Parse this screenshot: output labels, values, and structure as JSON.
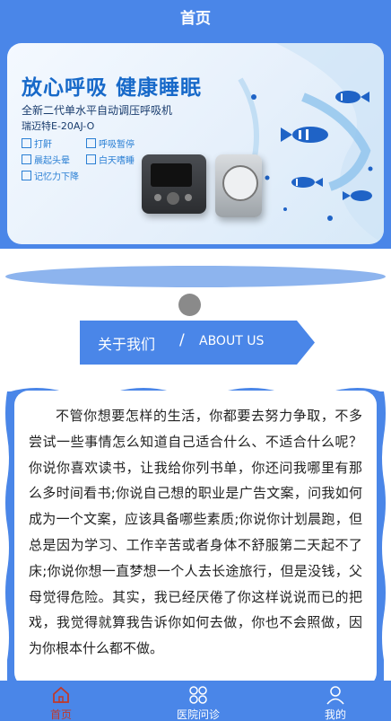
{
  "header": {
    "title": "首页"
  },
  "banner": {
    "headline": "放心呼吸  健康睡眠",
    "subtitle1": "全新二代单水平自动调压呼吸机",
    "subtitle2": "瑞迈特E-20AJ-O",
    "features": [
      "打鼾",
      "呼吸暂停",
      "晨起头晕",
      "白天嗜睡",
      "记忆力下降"
    ]
  },
  "about": {
    "title_cn": "关于我们",
    "separator": "/",
    "title_en": "ABOUT US"
  },
  "content": {
    "paragraph": "不管你想要怎样的生活，你都要去努力争取，不多尝试一些事情怎么知道自己适合什么、不适合什么呢？你说你喜欢读书，让我给你列书单，你还问我哪里有那么多时间看书;你说自己想的职业是广告文案，问我如何成为一个文案，应该具备哪些素质;你说你计划晨跑，但总是因为学习、工作辛苦或者身体不舒服第二天起不了床;你说你想一直梦想一个人去长途旅行，但是没钱，父母觉得危险。其实，我已经厌倦了你这样说说而已的把戏，我觉得就算我告诉你如何去做，你也不会照做，因为你根本什么都不做。"
  },
  "bottom_nav": [
    {
      "label": "首页",
      "icon": "home-icon",
      "active": true
    },
    {
      "label": "医院问诊",
      "icon": "grid-icon",
      "active": false
    },
    {
      "label": "我的",
      "icon": "user-icon",
      "active": false
    }
  ],
  "colors": {
    "primary": "#4a86e8",
    "nav_active": "#c0392b",
    "nav_inactive": "#ffffff"
  }
}
